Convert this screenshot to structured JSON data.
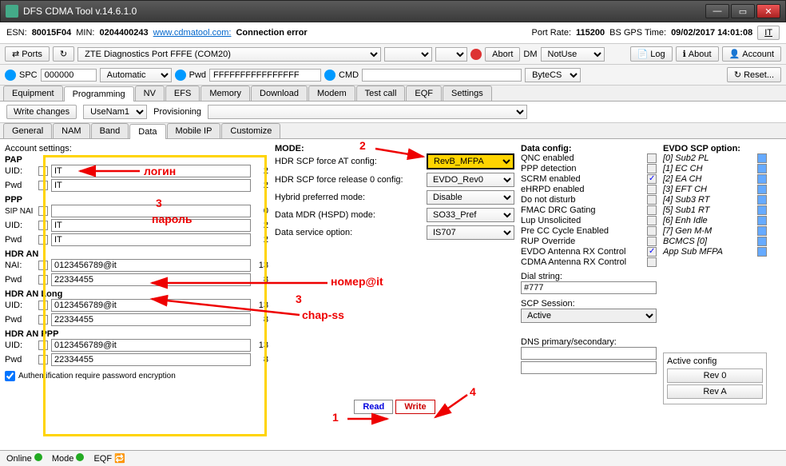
{
  "window": {
    "title": "DFS CDMA Tool v.14.6.1.0"
  },
  "header": {
    "esn_label": "ESN:",
    "esn": "80015F04",
    "min_label": "MIN:",
    "min": "0204400243",
    "link": "www.cdmatool.com:",
    "conn": "Connection error",
    "portrate_label": "Port Rate:",
    "portrate": "115200",
    "gpstime_label": "BS GPS Time:",
    "gpstime": "09/02/2017 14:01:08",
    "it": "IT"
  },
  "toolbar1": {
    "ports": "Ports",
    "portselect": "ZTE Diagnostics Port FFFE (COM20)",
    "abort": "Abort",
    "dm": "DM",
    "dmselect": "NotUse",
    "log": "Log",
    "about": "About",
    "account": "Account"
  },
  "toolbar2": {
    "spc_label": "SPC",
    "spc": "000000",
    "auto": "Automatic",
    "pwd_label": "Pwd",
    "pwd": "FFFFFFFFFFFFFFFF",
    "cmd_label": "CMD",
    "bytecs": "ByteCS",
    "reset": "Reset..."
  },
  "maintabs": [
    "Equipment",
    "Programming",
    "NV",
    "EFS",
    "Memory",
    "Download",
    "Modem",
    "Test call",
    "EQF",
    "Settings"
  ],
  "subrow": {
    "write": "Write changes",
    "usenam": "UseNam1",
    "prov": "Provisioning"
  },
  "subtabs": [
    "General",
    "NAM",
    "Band",
    "Data",
    "Mobile IP",
    "Customize"
  ],
  "account": {
    "title": "Account settings:",
    "pap": "PAP",
    "uid": "UID:",
    "pwd": "Pwd",
    "ppp": "PPP",
    "sipnai": "SIP NAI",
    "hdran": "HDR AN",
    "nai": "NAI:",
    "hdranlong": "HDR AN Long",
    "hdranppp": "HDR AN PPP",
    "auth": "Authentification require password encryption",
    "it": "IT",
    "nai_val": "0123456789@it",
    "long_pwd": "22334455",
    "ppp_pwd2": "22334455",
    "n2": "2",
    "n0": "0",
    "n13": "13",
    "n8": "8"
  },
  "mode": {
    "title": "MODE:",
    "r1": "HDR SCP force AT config:",
    "r1v": "RevB_MFPA",
    "r2": "HDR SCP force release 0 config:",
    "r2v": "EVDO_Rev0",
    "r3": "Hybrid preferred mode:",
    "r3v": "Disable",
    "r4": "Data MDR (HSPD) mode:",
    "r4v": "SO33_Pref",
    "r5": "Data service option:",
    "r5v": "IS707"
  },
  "datacfg": {
    "title": "Data config:",
    "items": [
      "QNC enabled",
      "PPP detection",
      "SCRM enabled",
      "eHRPD enabled",
      "Do not disturb",
      "FMAC DRC Gating",
      "Lup Unsolicited",
      "Pre CC Cycle Enabled",
      "RUP Override",
      "EVDO Antenna RX Control",
      "CDMA Antenna RX Control"
    ],
    "dial_label": "Dial string:",
    "dial": "#777",
    "scp_label": "SCP Session:",
    "scp": "Active",
    "dns_label": "DNS primary/secondary:"
  },
  "scp": {
    "title": "EVDO SCP option:",
    "items": [
      "[0] Sub2 PL",
      "[1] EC CH",
      "[2] EA CH",
      "[3] EFT CH",
      "[4] Sub3 RT",
      "[5] Sub1 RT",
      "[6] Enh Idle",
      "[7] Gen M-M",
      "BCMCS [0]",
      "App Sub MFPA"
    ],
    "active_title": "Active config",
    "rev0": "Rev 0",
    "reva": "Rev A"
  },
  "buttons": {
    "read": "Read",
    "write": "Write"
  },
  "status": {
    "online": "Online",
    "mode": "Mode",
    "eqf": "EQF"
  },
  "annotations": {
    "login": "логин",
    "password": "пароль",
    "nomer": "номер@it",
    "chapss": "chap-ss",
    "n1": "1",
    "n2": "2",
    "n3": "3",
    "n4": "4"
  }
}
